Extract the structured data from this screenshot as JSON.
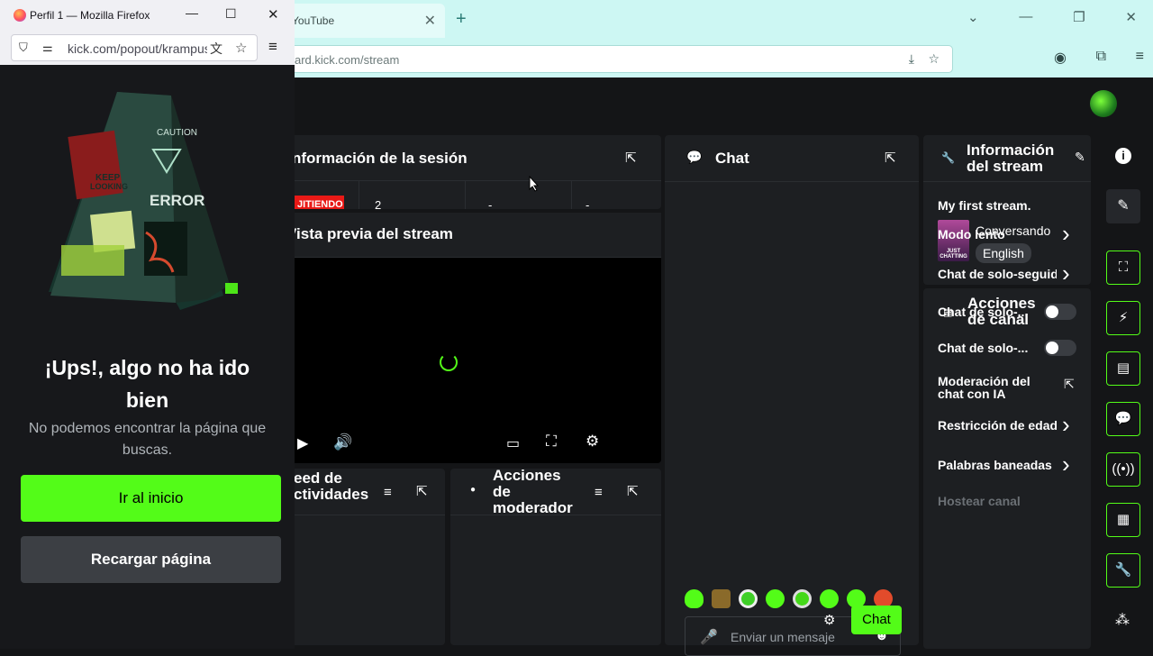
{
  "background_browser": {
    "tab_label": "YouTube",
    "url_prefix": "ard.kick.com",
    "url_path": "/stream"
  },
  "dashboard": {
    "session_panel": {
      "title": "nformación de la sesión",
      "live_badge": "JITIENDO",
      "stat1": "2",
      "stat2": "-",
      "stat3": "-"
    },
    "preview_panel": {
      "title": "Vista previa del stream"
    },
    "activity_panel": {
      "title_l1": "eed de",
      "title_l2": "ctividades"
    },
    "mod_panel": {
      "title_l1": "Acciones",
      "title_l2": "de",
      "title_l3": "moderador"
    },
    "chat_panel": {
      "title": "Chat",
      "input_placeholder": "Enviar un mensaje",
      "send_label": "Chat"
    },
    "stream_info_panel": {
      "title_l1": "Información",
      "title_l2": "del stream",
      "stream_title": "My first stream.",
      "category": "Conversando",
      "language": "English",
      "thumb_text": "JUST CHATTING"
    },
    "channel_actions_panel": {
      "title_l1": "Acciones",
      "title_l2": "de canal",
      "items": [
        {
          "label": "Modo lento",
          "control": "chevron"
        },
        {
          "label": "Chat de solo-seguidores",
          "control": "chevron"
        },
        {
          "label": "Chat de solo-...",
          "control": "toggle"
        },
        {
          "label": "Chat de solo-...",
          "control": "toggle"
        },
        {
          "label": "Moderación del chat con IA",
          "control": "external"
        },
        {
          "label": "Restricción de edad",
          "control": "chevron"
        },
        {
          "label": "Palabras baneadas",
          "control": "chevron"
        },
        {
          "label": "Hostear canal",
          "control": "none"
        }
      ]
    },
    "accent_color": "#53fc18"
  },
  "firefox_popup": {
    "window_title": "Perfil 1 — Mozilla Firefox",
    "url": "kick.com/popout/krampus",
    "error_heading_l1": "¡Ups!, algo no ha ido",
    "error_heading_l2": "bien",
    "error_message_l1": "No podemos encontrar la página que",
    "error_message_l2": "buscas.",
    "home_button": "Ir al inicio",
    "reload_button": "Recargar página",
    "sign_caution": "CAUTION",
    "sign_error": "ERROR",
    "sign_keep": "KEEP",
    "sign_looking": "LOOKING"
  }
}
